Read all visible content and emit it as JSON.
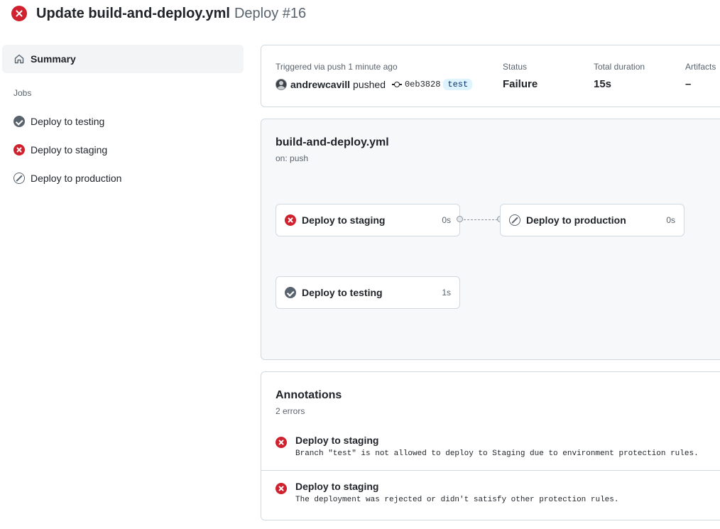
{
  "header": {
    "title": "Update build-and-deploy.yml",
    "subtitle": "Deploy #16"
  },
  "sidebar": {
    "summary_label": "Summary",
    "jobs_heading": "Jobs",
    "jobs": [
      {
        "label": "Deploy to testing",
        "status": "success"
      },
      {
        "label": "Deploy to staging",
        "status": "failure"
      },
      {
        "label": "Deploy to production",
        "status": "skipped"
      }
    ]
  },
  "run_info": {
    "trigger": "Triggered via push 1 minute ago",
    "user": "andrewcavill",
    "action": "pushed",
    "sha": "0eb3828",
    "branch": "test",
    "status_label": "Status",
    "status_value": "Failure",
    "duration_label": "Total duration",
    "duration_value": "15s",
    "artifacts_label": "Artifacts",
    "artifacts_value": "–"
  },
  "workflow": {
    "name": "build-and-deploy.yml",
    "trigger": "on: push",
    "jobs": [
      {
        "label": "Deploy to staging",
        "duration": "0s",
        "status": "failure"
      },
      {
        "label": "Deploy to production",
        "duration": "0s",
        "status": "skipped"
      },
      {
        "label": "Deploy to testing",
        "duration": "1s",
        "status": "success"
      }
    ]
  },
  "annotations": {
    "title": "Annotations",
    "count": "2 errors",
    "items": [
      {
        "title": "Deploy to staging",
        "message": "Branch \"test\" is not allowed to deploy to Staging due to environment protection rules."
      },
      {
        "title": "Deploy to staging",
        "message": "The deployment was rejected or didn't satisfy other protection rules."
      }
    ]
  },
  "colors": {
    "failure": "#cf222e",
    "success": "#59636e",
    "muted": "#59636e",
    "border": "#d1d9e0",
    "branch_bg": "#ddf4ff"
  }
}
